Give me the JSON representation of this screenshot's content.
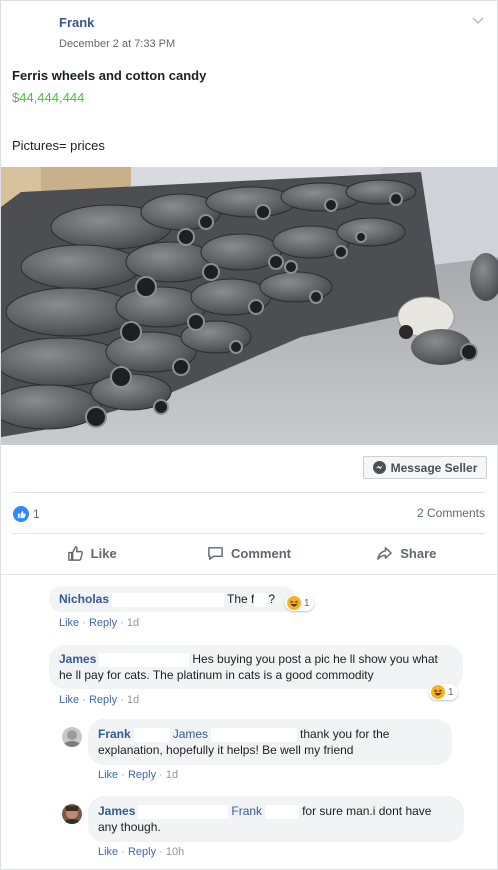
{
  "post": {
    "author": "Frank",
    "timestamp": "December 2 at 7:33 PM",
    "title": "Ferris wheels and cotton candy",
    "price": "$44,444,444",
    "description": "Pictures= prices",
    "message_seller": "Message Seller",
    "like_count": "1",
    "comment_count": "2 Comments"
  },
  "actions": {
    "like": "Like",
    "comment": "Comment",
    "share": "Share"
  },
  "comments": [
    {
      "name": "Nicholas",
      "text": "The f",
      "text_end": "?",
      "reaction_count": "1",
      "like": "Like",
      "reply": "Reply",
      "age": "1d"
    },
    {
      "name": "James",
      "text": "Hes buying you post a pic he ll show you what he ll pay for cats. The platinum in cats is a good commodity",
      "reaction_count": "1",
      "like": "Like",
      "reply": "Reply",
      "age": "1d"
    }
  ],
  "replies": [
    {
      "name": "Frank",
      "tag": "James",
      "text": "thank you for the explanation, hopefully it helps! Be well my friend",
      "like": "Like",
      "reply": "Reply",
      "age": "1d"
    },
    {
      "name": "James",
      "tag": "Frank",
      "text": "for sure man.i dont have any though.",
      "like": "Like",
      "reply": "Reply",
      "age": "10h"
    }
  ],
  "colors": {
    "link": "#365899",
    "price": "#4bbe3f",
    "like_blue": "#2d88ff",
    "meta": "#90949c"
  },
  "icons": [
    "chevron-down-icon",
    "messenger-icon",
    "like-icon",
    "thumbs-up-icon",
    "comment-icon",
    "share-icon",
    "haha-icon"
  ]
}
